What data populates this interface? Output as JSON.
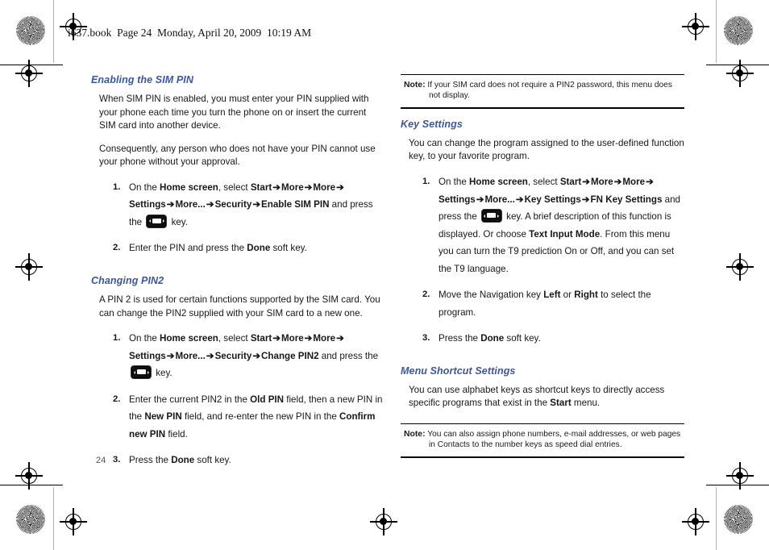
{
  "document": {
    "header_line": "i637.book  Page 24  Monday, April 20, 2009  10:19 AM",
    "page_number": "24",
    "heading_color": "#3a57a6",
    "key_icon_name": "ok-select-key-icon"
  },
  "left_column": {
    "section1": {
      "heading": "Enabling the SIM PIN",
      "para1": "When SIM PIN is enabled, you must enter your PIN supplied with your phone each time you turn the phone on or insert the current SIM card into another device.",
      "para2": "Consequently, any person who does not have your PIN cannot use your phone without your approval.",
      "step1": {
        "t1": "On the ",
        "b1": "Home screen",
        "t2": ", select ",
        "b2": "Start",
        "a1": "➔",
        "b3": "More",
        "a2": "➔",
        "b4": "More",
        "a3": "➔",
        "b5": "Settings",
        "a4": "➔",
        "b6": "More...",
        "a5": "➔",
        "b7": "Security",
        "a6": "➔",
        "b8": "Enable SIM PIN",
        "t3": " and press the ",
        "t4": " key."
      },
      "step2": {
        "t1": "Enter the PIN and press the ",
        "b1": "Done",
        "t2": " soft key."
      }
    },
    "section2": {
      "heading": "Changing PIN2",
      "para1": "A PIN 2 is used for certain functions supported by the SIM card. You can change the PIN2 supplied with your SIM card to a new one.",
      "step1": {
        "t1": "On the ",
        "b1": "Home screen",
        "t2": ", select ",
        "b2": "Start",
        "a1": "➔",
        "b3": "More",
        "a2": "➔",
        "b4": "More",
        "a3": "➔",
        "b5": "Settings",
        "a4": "➔",
        "b6": "More...",
        "a5": "➔",
        "b7": "Security",
        "a6": "➔",
        "b8": "Change PIN2",
        "t3": " and press the ",
        "t4": " key."
      },
      "step2": {
        "t1": "Enter the current PIN2 in the ",
        "b1": "Old PIN",
        "t2": " field, then a new PIN in the ",
        "b2": "New PIN",
        "t3": " field, and re-enter the new PIN in the ",
        "b3": "Confirm new PIN",
        "t4": " field."
      },
      "step3": {
        "t1": "Press the ",
        "b1": "Done",
        "t2": " soft key."
      }
    }
  },
  "right_column": {
    "note_top": {
      "label": "Note:",
      "body": "If your SIM card does not require a PIN2 password, this menu does not display."
    },
    "section1": {
      "heading": "Key Settings",
      "para1": "You can change the program assigned to the user-defined function key, to your favorite program.",
      "step1": {
        "t1": "On the ",
        "b1": "Home screen",
        "t2": ", select ",
        "b2": "Start",
        "a1": "➔",
        "b3": "More",
        "a2": "➔",
        "b4": "More",
        "a3": "➔",
        "b5": "Settings",
        "a4": "➔",
        "b6": "More...",
        "a5": "➔",
        "b7": "Key Settings",
        "a6": "➔",
        "b8": "FN Key Settings",
        "t3": " and press the ",
        "t4": " key. A brief description of this function is displayed. Or choose ",
        "b9": "Text Input Mode",
        "t5": ". From this menu you can turn the T9 prediction On or Off, and you can set the T9 language."
      },
      "step2": {
        "t1": "Move the Navigation key ",
        "b1": "Left",
        "t2": " or ",
        "b2": "Right",
        "t3": " to select the program."
      },
      "step3": {
        "t1": "Press the ",
        "b1": "Done",
        "t2": " soft key."
      }
    },
    "section2": {
      "heading": "Menu Shortcut Settings",
      "para1_a": "You can use alphabet keys as shortcut keys to directly access specific programs that exist in the ",
      "para1_b": "Start",
      "para1_c": " menu."
    },
    "note_bottom": {
      "label": "Note:",
      "body": "You can also assign phone numbers, e-mail addresses, or web pages in Contacts to the number keys as speed dial entries."
    }
  }
}
